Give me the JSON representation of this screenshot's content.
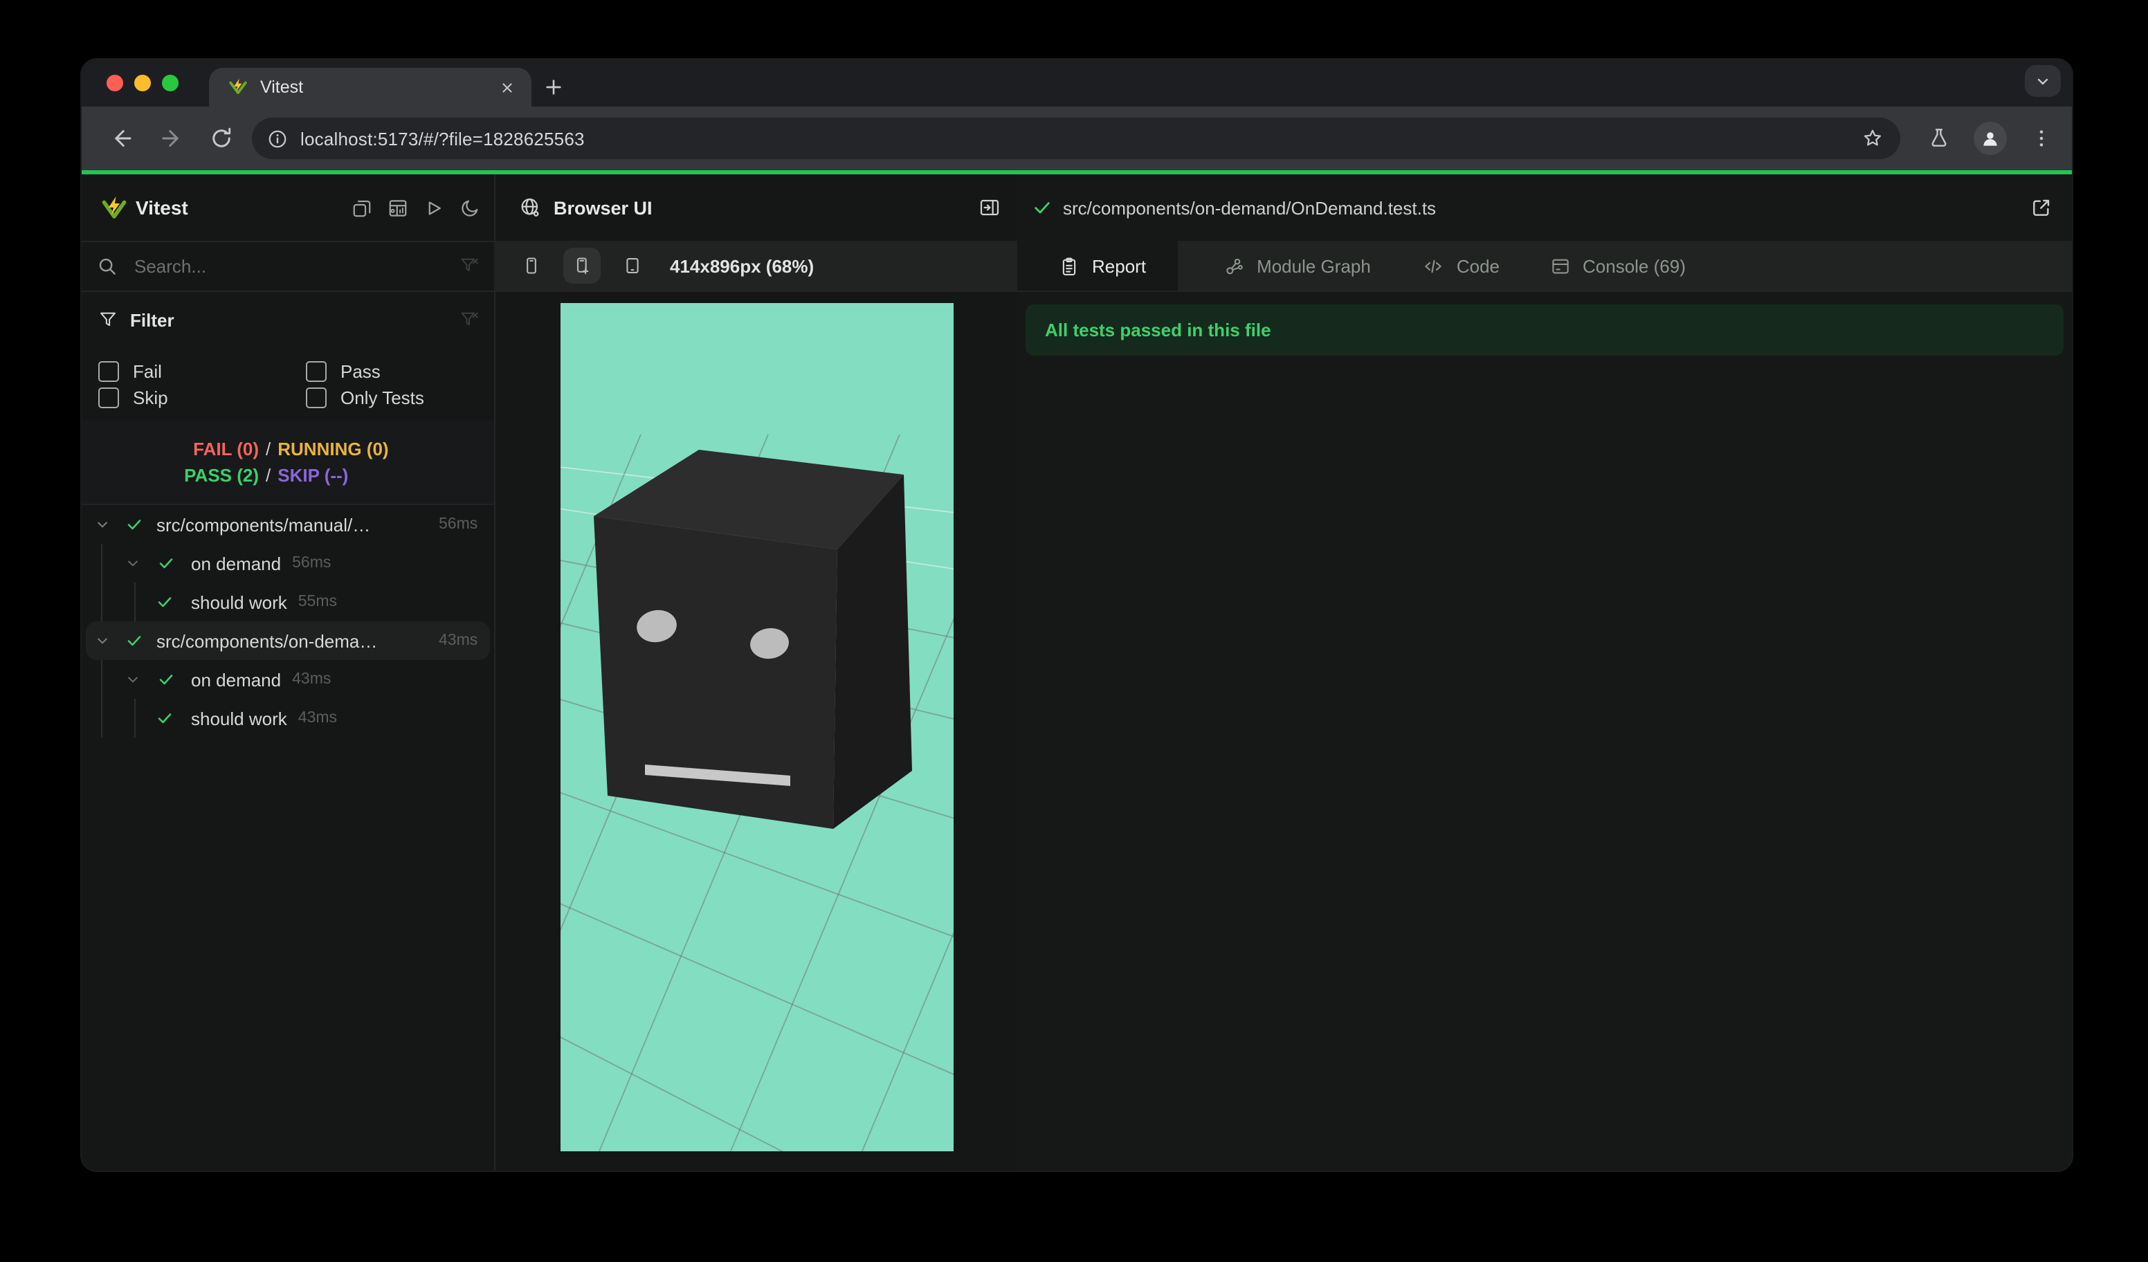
{
  "colors": {
    "progress": "#22c553",
    "pass": "#3ecf6b",
    "fail": "#f4645f",
    "running": "#e9b43c",
    "skip": "#8b66d9",
    "viewport_bg": "#83ddc1",
    "banner_bg": "#152a1c",
    "banner_text": "#3fd06c",
    "cube_top": "#2d2d2d",
    "cube_front": "#262626",
    "cube_side": "#1b1b1b",
    "cube_eye": "#bcbcbc",
    "vitest_yellow": "#fcc72b",
    "vitest_green": "#6cab26"
  },
  "browser": {
    "tab_title": "Vitest",
    "url": "localhost:5173/#/?file=1828625563"
  },
  "sidebar": {
    "app_name": "Vitest",
    "search_placeholder": "Search...",
    "filter": {
      "title": "Filter",
      "options": [
        {
          "label": "Fail",
          "checked": false
        },
        {
          "label": "Pass",
          "checked": false
        },
        {
          "label": "Skip",
          "checked": false
        },
        {
          "label": "Only Tests",
          "checked": false
        }
      ]
    },
    "summary": {
      "fail": "FAIL (0)",
      "running": "RUNNING (0)",
      "pass": "PASS (2)",
      "skip": "SKIP (--)",
      "separator": "/"
    },
    "tree": [
      {
        "level": 1,
        "label": "src/components/manual/…",
        "duration": "56ms",
        "status": "pass",
        "selected": false
      },
      {
        "level": 2,
        "label": "on demand",
        "duration": "56ms",
        "status": "pass"
      },
      {
        "level": 3,
        "label": "should work",
        "duration": "55ms",
        "status": "pass"
      },
      {
        "level": 1,
        "label": "src/components/on-dema…",
        "duration": "43ms",
        "status": "pass",
        "selected": true
      },
      {
        "level": 2,
        "label": "on demand",
        "duration": "43ms",
        "status": "pass"
      },
      {
        "level": 3,
        "label": "should work",
        "duration": "43ms",
        "status": "pass"
      }
    ]
  },
  "middle": {
    "title": "Browser UI",
    "viewport_size_label": "414x896px (68%)"
  },
  "right": {
    "file_path": "src/components/on-demand/OnDemand.test.ts",
    "tabs": [
      {
        "label": "Report",
        "active": true
      },
      {
        "label": "Module Graph",
        "active": false
      },
      {
        "label": "Code",
        "active": false
      },
      {
        "label": "Console (69)",
        "active": false
      }
    ],
    "banner": "All tests passed in this file"
  }
}
